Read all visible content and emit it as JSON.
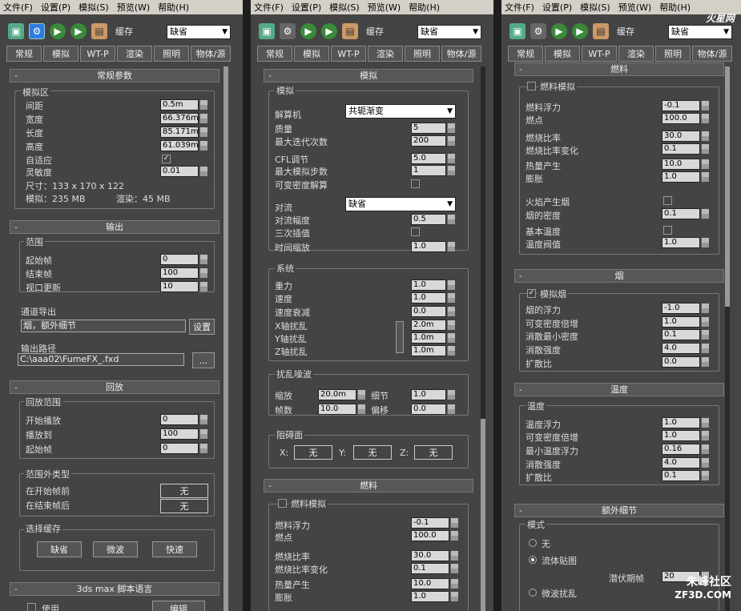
{
  "menu": [
    "文件(F)",
    "设置(P)",
    "模拟(S)",
    "预览(W)",
    "帮助(H)"
  ],
  "toolbar": {
    "cache_label": "缓存",
    "cache_value": "缺省"
  },
  "tabs": [
    "常规",
    "模拟",
    "WT-P",
    "渲染",
    "照明",
    "物体/源"
  ],
  "p1": {
    "general_title": "常规参数",
    "sim_area": "模拟区",
    "spacing": "间距",
    "spacing_v": "0.5m",
    "width": "宽度",
    "width_v": "66.376m",
    "length": "长度",
    "length_v": "85.171m",
    "height": "高度",
    "height_v": "61.039m",
    "adaptive": "自适应",
    "sensitivity": "灵敏度",
    "sensitivity_v": "0.01",
    "size": "尺寸：133 x 170 x 122",
    "sim_mem": "模拟：235 MB",
    "render_mem": "渲染：45 MB",
    "output_title": "输出",
    "range": "范围",
    "start": "起始帧",
    "start_v": "0",
    "end": "结束帧",
    "end_v": "100",
    "vp": "视口更新",
    "vp_v": "10",
    "channel": "通道导出",
    "channel_v": "烟，额外细节",
    "setup": "设置",
    "path": "输出路径",
    "path_v": "C:\\aaa02\\FumeFX_.fxd",
    "browse": "...",
    "playback_title": "回放",
    "pb_range": "回放范围",
    "play_start": "开始播放",
    "play_start_v": "0",
    "play_to": "播放到",
    "play_to_v": "100",
    "first": "起始帧",
    "first_v": "0",
    "out_type": "范围外类型",
    "before": "在开始帧前",
    "before_v": "无",
    "after": "在结束帧后",
    "after_v": "无",
    "sel_cache": "选择缓存",
    "c1": "缺省",
    "c2": "微波",
    "c3": "快速",
    "script_title": "3ds max 脚本语言",
    "use": "使用",
    "edit": "编辑"
  },
  "p2": {
    "sim_title": "模拟",
    "sim_grp": "模拟",
    "solver": "解算机",
    "solver_v": "共轭渐变",
    "quality": "质量",
    "quality_v": "5",
    "maxiter": "最大迭代次数",
    "maxiter_v": "200",
    "cfl": "CFL调节",
    "cfl_v": "5.0",
    "maxsteps": "最大模拟步数",
    "maxsteps_v": "1",
    "vardens": "可变密度解算",
    "conv": "对流",
    "conv_v": "缺省",
    "convamp": "对流幅度",
    "convamp_v": "0.5",
    "cubic": "三次插值",
    "timescale": "时间缩放",
    "timescale_v": "1.0",
    "system": "系统",
    "gravity": "重力",
    "gravity_v": "1.0",
    "vel": "速度",
    "vel_v": "1.0",
    "veldamp": "速度衰减",
    "veldamp_v": "0.0",
    "xt": "X轴扰乱",
    "xt_v": "2.0m",
    "yt": "Y轴扰乱",
    "yt_v": "1.0m",
    "zt": "Z轴扰乱",
    "zt_v": "1.0m",
    "noise": "扰乱噪波",
    "scale": "缩放",
    "scale_v": "20.0m",
    "detail": "细节",
    "detail_v": "1.0",
    "frames": "帧数",
    "frames_v": "10.0",
    "offset": "偏移",
    "offset_v": "0.0",
    "obstacle": "阻碍面",
    "x": "X:",
    "y": "Y:",
    "z": "Z:",
    "none": "无",
    "fuel_title": "燃料",
    "fuel_sim": "燃料模拟",
    "buoy": "燃料浮力",
    "buoy_v": "-0.1",
    "ign": "燃点",
    "ign_v": "100.0",
    "burn": "燃烧比率",
    "burn_v": "30.0",
    "burnvar": "燃烧比率变化",
    "burnvar_v": "0.1",
    "heat": "热量产生",
    "heat_v": "10.0",
    "exp": "膨胀",
    "exp_v": "1.0"
  },
  "p3": {
    "fuel_title": "燃料",
    "fuel_sim": "燃料模拟",
    "buoy": "燃料浮力",
    "buoy_v": "-0.1",
    "ign": "燃点",
    "ign_v": "100.0",
    "burn": "燃烧比率",
    "burn_v": "30.0",
    "burnvar": "燃烧比率变化",
    "burnvar_v": "0.1",
    "heat": "热量产生",
    "heat_v": "10.0",
    "exp": "膨胀",
    "exp_v": "1.0",
    "flame": "火焰产生烟",
    "smokedens": "烟的密度",
    "smokedens_v": "0.1",
    "basetemp": "基本温度",
    "tempth": "温度阀值",
    "tempth_v": "1.0",
    "smoke_title": "烟",
    "simsmoke": "模拟烟",
    "sbuoy": "烟的浮力",
    "sbuoy_v": "-1.0",
    "svd": "可变密度倍增",
    "svd_v": "1.0",
    "sdmin": "消散最小密度",
    "sdmin_v": "0.1",
    "sds": "消散强度",
    "sds_v": "4.0",
    "sdiff": "扩散比",
    "sdiff_v": "0.0",
    "temp_title": "温度",
    "temp_grp": "温度",
    "tbuoy": "温度浮力",
    "tbuoy_v": "1.0",
    "tvd": "可变密度倍增",
    "tvd_v": "1.0",
    "tmin": "最小温度浮力",
    "tmin_v": "0.16",
    "tds": "消散强度",
    "tds_v": "4.0",
    "tdiff": "扩散比",
    "tdiff_v": "0.1",
    "extra_title": "额外细节",
    "mode": "模式",
    "m_none": "无",
    "m_fluid": "流体贴图",
    "latent": "潜伏期帧",
    "latent_v": "20",
    "m_wave": "微波扰乱"
  },
  "watermark": {
    "top": "火星网",
    "bottom": "朱峰社区",
    "domain": "ZF3D.COM"
  }
}
